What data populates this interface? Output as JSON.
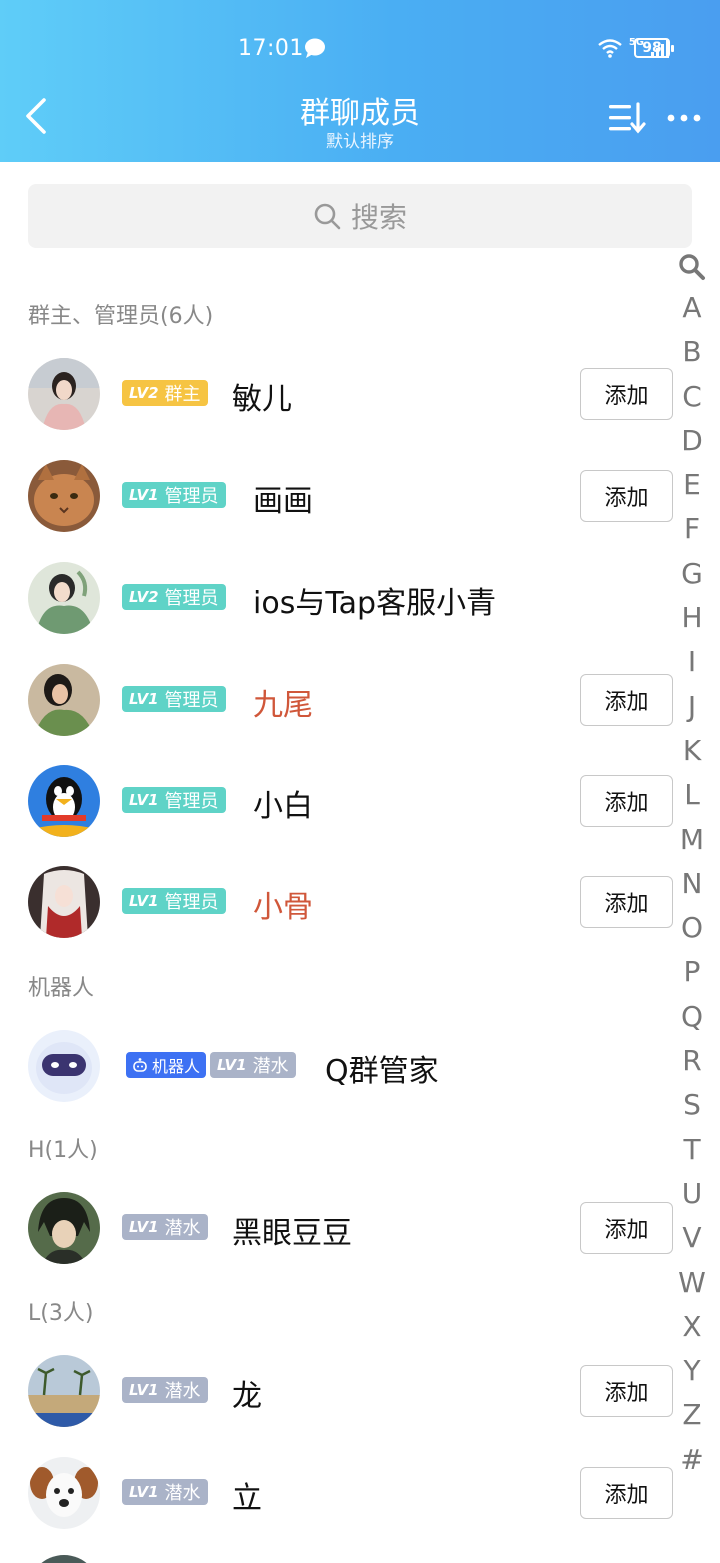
{
  "status_bar": {
    "time": "17:01",
    "network": "5G",
    "battery": "98"
  },
  "header": {
    "title": "群聊成员",
    "subtitle": "默认排序"
  },
  "search": {
    "placeholder": "搜索"
  },
  "sections": {
    "admins": "群主、管理员(6人)",
    "robots": "机器人",
    "h": "H(1人)",
    "l": "L(3人)"
  },
  "add_label": "添加",
  "members": [
    {
      "level": "LV2",
      "role": "群主",
      "name": "敏儿"
    },
    {
      "level": "LV1",
      "role": "管理员",
      "name": "画画"
    },
    {
      "level": "LV2",
      "role": "管理员",
      "name": "ios与Tap客服小青"
    },
    {
      "level": "LV1",
      "role": "管理员",
      "name": "九尾"
    },
    {
      "level": "LV1",
      "role": "管理员",
      "name": "小白"
    },
    {
      "level": "LV1",
      "role": "管理员",
      "name": "小骨"
    },
    {
      "tag": "机器人",
      "level": "LV1",
      "role": "潜水",
      "name": "Q群管家"
    },
    {
      "level": "LV1",
      "role": "潜水",
      "name": "黑眼豆豆"
    },
    {
      "level": "LV1",
      "role": "潜水",
      "name": "龙"
    },
    {
      "level": "LV1",
      "role": "潜水",
      "name": "立"
    }
  ],
  "index_letters": [
    "A",
    "B",
    "C",
    "D",
    "E",
    "F",
    "G",
    "H",
    "I",
    "J",
    "K",
    "L",
    "M",
    "N",
    "O",
    "P",
    "Q",
    "R",
    "S",
    "T",
    "U",
    "V",
    "W",
    "X",
    "Y",
    "Z",
    "#"
  ],
  "colors": {
    "header_start": "#5fcdf8",
    "header_end": "#4a9ef0",
    "owner_badge": "#f6c443",
    "admin_badge": "#5fd3c7",
    "dive_badge": "#aab3c8",
    "bot_badge": "#3d71f3",
    "highlight_name": "#d0573a"
  }
}
